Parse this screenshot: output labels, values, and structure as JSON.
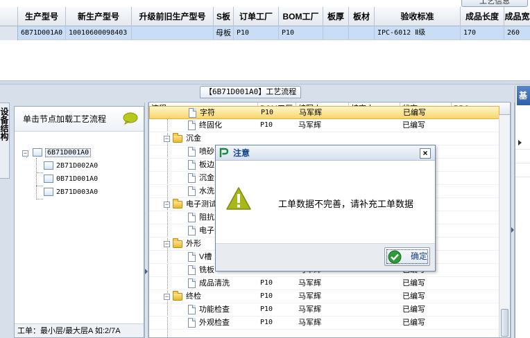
{
  "top_grid": {
    "top_button_label": "工艺信息",
    "columns": [
      "生产型号",
      "新生产型号",
      "升级前旧生产型号",
      "S板",
      "订单工厂",
      "BOM工厂",
      "板厚",
      "板材",
      "验收标准",
      "成品长度",
      "成品宽"
    ],
    "row": [
      "6B71D001A0",
      "10010600098403",
      "",
      "母板",
      "P10",
      "P10",
      "",
      "",
      "IPC-6012 Ⅱ级",
      "170",
      "260"
    ]
  },
  "left_tab_label": "设备结构",
  "panel_title": "【6B71D001A0】工艺流程",
  "tree": {
    "header_label": "单击节点加载工艺流程",
    "expander_symbol": "−",
    "nodes": [
      "6B71D001A0",
      "2B71D002A0",
      "0B71D001A0",
      "2B71D003A0"
    ],
    "status": "工单：最小层/最大层A 如:2/7A"
  },
  "process_grid": {
    "columns": [
      "流程",
      "BOM工厂",
      "编写人",
      "核审人",
      "状态",
      "PPC"
    ],
    "collapse_symbol": "−",
    "rows": [
      {
        "type": "step",
        "name": "字符",
        "bom": "P10",
        "author": "马军辉",
        "reviewer": "",
        "status": "已编写",
        "highlight": true
      },
      {
        "type": "step",
        "name": "终固化",
        "bom": "P10",
        "author": "马军辉",
        "reviewer": "",
        "status": "已编写"
      },
      {
        "type": "group",
        "name": "沉金"
      },
      {
        "type": "step",
        "name": "喷砂",
        "bom": "",
        "author": "",
        "reviewer": "",
        "status": ""
      },
      {
        "type": "step",
        "name": "板边",
        "bom": "",
        "author": "",
        "reviewer": "",
        "status": ""
      },
      {
        "type": "step",
        "name": "沉金",
        "bom": "",
        "author": "",
        "reviewer": "",
        "status": ""
      },
      {
        "type": "step",
        "name": "水洗",
        "bom": "",
        "author": "",
        "reviewer": "",
        "status": ""
      },
      {
        "type": "group",
        "name": "电子测试"
      },
      {
        "type": "step",
        "name": "阻抗",
        "bom": "",
        "author": "",
        "reviewer": "",
        "status": ""
      },
      {
        "type": "step",
        "name": "电子测试",
        "bom": "",
        "author": "",
        "reviewer": "",
        "status": ""
      },
      {
        "type": "group",
        "name": "外形"
      },
      {
        "type": "step",
        "name": "V槽",
        "bom": "",
        "author": "",
        "reviewer": "",
        "status": ""
      },
      {
        "type": "step",
        "name": "铣板",
        "bom": "P10",
        "author": "马军辉",
        "reviewer": "",
        "status": "已编写"
      },
      {
        "type": "step",
        "name": "成品清洗",
        "bom": "P10",
        "author": "马军辉",
        "reviewer": "",
        "status": "已编写"
      },
      {
        "type": "group",
        "name": "终检",
        "bom": "P10",
        "author": "马军辉",
        "reviewer": "",
        "status": "已编写"
      },
      {
        "type": "step",
        "name": "功能检查",
        "bom": "P10",
        "author": "马军辉",
        "reviewer": "",
        "status": "已编写"
      },
      {
        "type": "step",
        "name": "外观检查",
        "bom": "P10",
        "author": "马军辉",
        "reviewer": "",
        "status": "已编写"
      }
    ]
  },
  "right_panel": {
    "tab_label": "基"
  },
  "dialog": {
    "title": "注意",
    "close_symbol": "×",
    "message": "工单数据不完善，请补充工单数据",
    "ok_label": "确定"
  }
}
